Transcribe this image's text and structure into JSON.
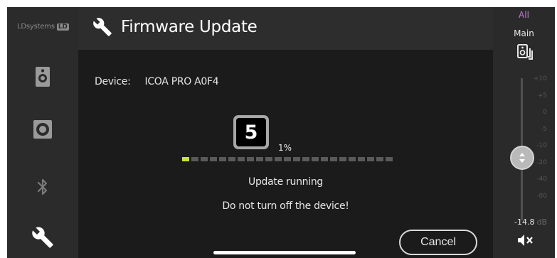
{
  "sidebar": {
    "brand": "LDsystems",
    "brand_badge": "LD",
    "items": [
      {
        "icon": "speaker-icon"
      },
      {
        "icon": "subwoofer-icon"
      },
      {
        "icon": "bluetooth-icon"
      },
      {
        "icon": "wrench-icon"
      }
    ]
  },
  "header": {
    "title": "Firmware Update",
    "icon": "wrench-icon"
  },
  "device": {
    "label": "Device:",
    "value": "ICOA PRO A0F4"
  },
  "step_badge": "5",
  "progress": {
    "percent_text": "1%",
    "value": 0.01,
    "segments": 23,
    "filled": 1,
    "accent": "#c8e62c"
  },
  "status": {
    "line1": "Update running",
    "line2": "Do not turn off the device!"
  },
  "cancel_label": "Cancel",
  "right_panel": {
    "all_label": "All",
    "main_label": "Main",
    "ticks": [
      "+10",
      "+5",
      "0",
      "-5",
      "-10",
      "-20",
      "-40",
      "-80"
    ],
    "level_value": "-14.8",
    "level_unit": "dB",
    "accent": "#c07bd8"
  }
}
